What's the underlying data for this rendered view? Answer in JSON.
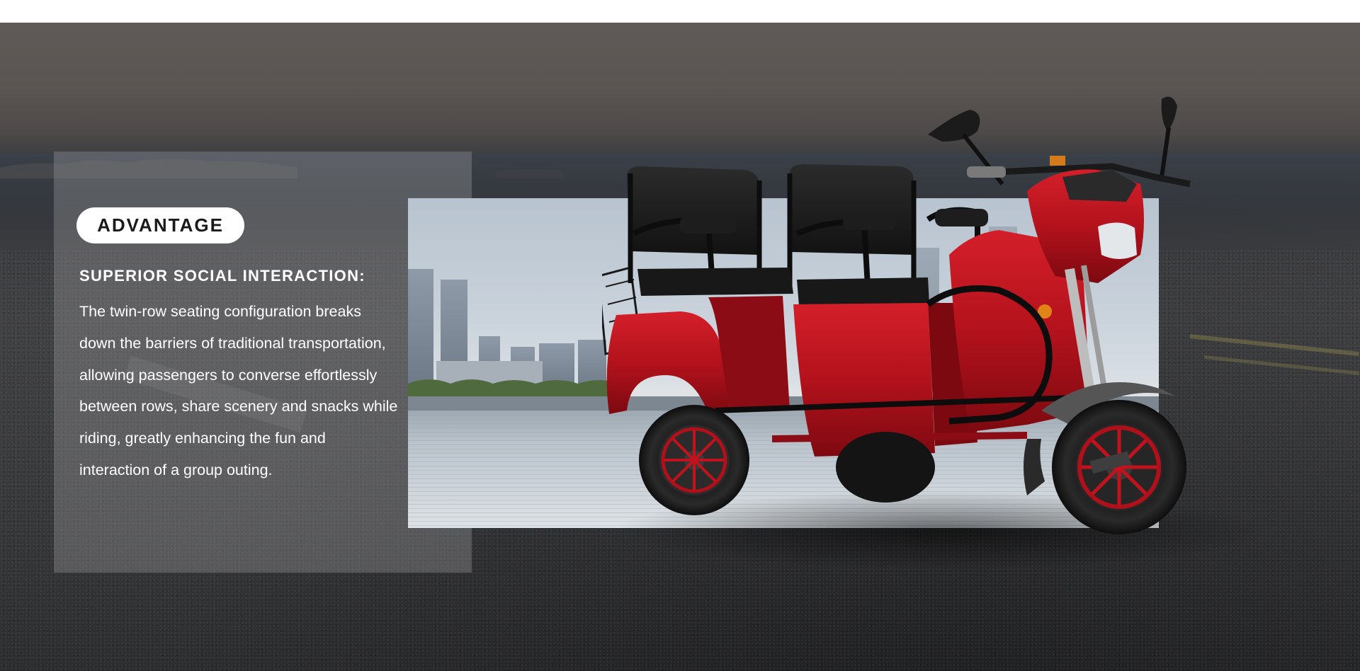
{
  "section": {
    "badge_label": "ADVANTAGE",
    "feature_title": "SUPERIOR SOCIAL INTERACTION:",
    "feature_body": "The twin-row seating configuration breaks down the barriers of traditional transportation, allowing passengers to converse effortlessly between rows, share scenery and snacks while riding, greatly enhancing the fun and interaction of a group outing."
  },
  "colors": {
    "background_top": "#5f5a57",
    "background_road": "#3b3c3e",
    "panel": "#969698",
    "badge_bg": "#ffffff",
    "badge_text": "#1a1a1a",
    "body_text": "#ffffff",
    "vehicle_body": "#b3121c",
    "vehicle_seat": "#1c1c1c"
  },
  "images": {
    "background": "coastal-road-scene",
    "city_photo": "city-skyline-plaza",
    "product": "red-two-row-electric-tricycle"
  }
}
